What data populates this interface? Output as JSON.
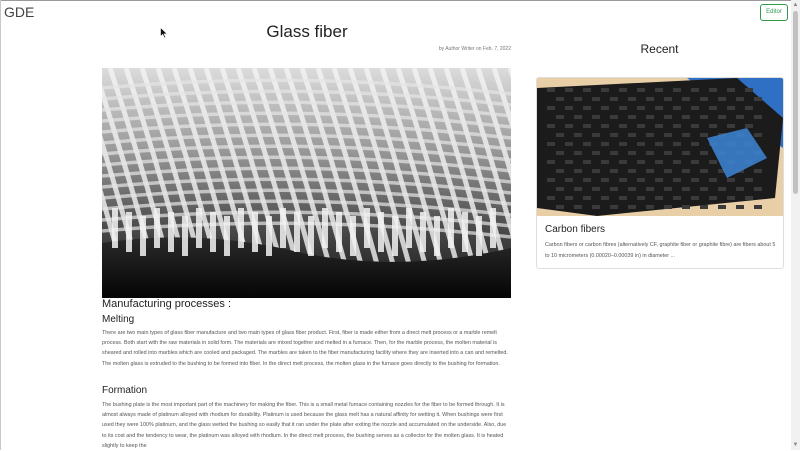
{
  "nav": {
    "brand": "GDE",
    "editor_label": "Editor"
  },
  "article": {
    "title": "Glass fiber",
    "byline": "by Author Writer on Feb. 7, 2022",
    "hero_image": "woven glass fiber fabric photo",
    "section_heading": "Manufacturing processes :",
    "melting": {
      "heading": "Melting",
      "text": "There are two main types of glass fiber manufacture and two main types of glass fiber product. First, fiber is made either from a direct melt process or a marble remelt process. Both start with the raw materials in solid form. The materials are mixed together and melted in a furnace. Then, for the marble process, the molten material is sheared and rolled into marbles which are cooled and packaged. The marbles are taken to the fiber manufacturing facility where they are inserted into a can and remelted. The molten glass is extruded to the bushing to be formed into fiber. In the direct melt process, the molten glass in the furnace goes directly to the bushing for formation."
    },
    "formation": {
      "heading": "Formation",
      "text": "The bushing plate is the most important part of the machinery for making the fiber. This is a small metal furnace containing nozzles for the fiber to be formed through. It is almost always made of platinum alloyed with rhodium for durability. Platinum is used because the glass melt has a natural affinity for wetting it. When bushings were first used they were 100% platinum, and the glass wetted the bushing so easily that it ran under the plate after exiting the nozzle and accumulated on the underside. Also, due to its cost and the tendency to wear, the platinum was alloyed with rhodium. In the direct melt process, the bushing serves as a collector for the molten glass. It is heated slightly to keep the"
    }
  },
  "sidebar": {
    "heading": "Recent",
    "cards": [
      {
        "title": "Carbon fibers",
        "text": "Carbon fibers or carbon fibres (alternatively CF, graphite fiber or graphite fibre) are fibers about 5 to 10 micrometers (0.00020–0.00039 in) in diameter ...",
        "image": "carbon fiber weave photo"
      }
    ]
  },
  "colors": {
    "accent_green": "#2e9a4b",
    "text": "#222222",
    "muted": "#555555"
  }
}
